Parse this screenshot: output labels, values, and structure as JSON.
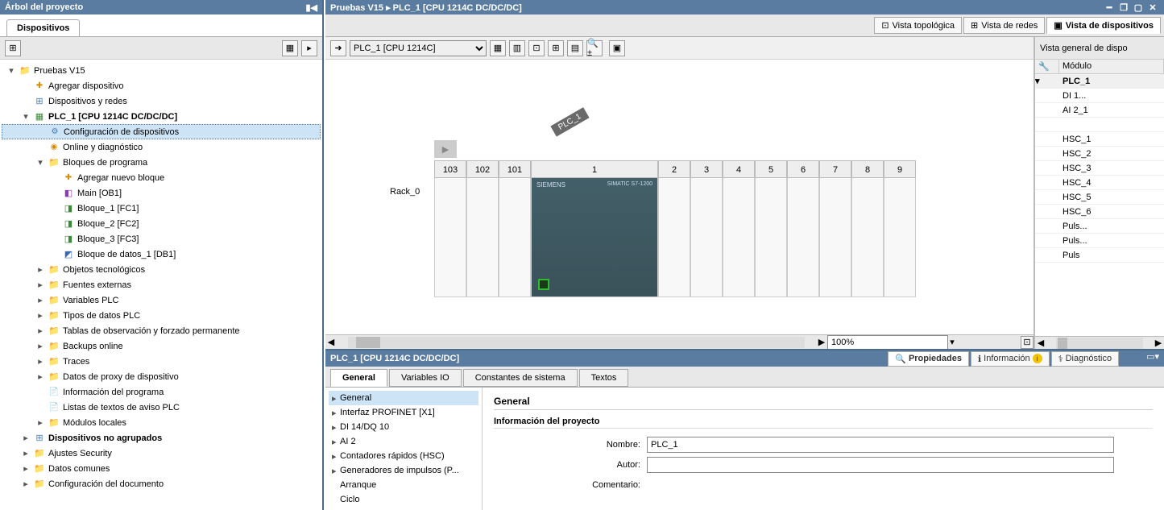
{
  "left_panel": {
    "title": "Árbol del proyecto",
    "tab": "Dispositivos",
    "tree": [
      {
        "level": 0,
        "exp": "▾",
        "icon": "ic-folder",
        "label": "Pruebas V15",
        "bold": false
      },
      {
        "level": 1,
        "exp": "",
        "icon": "ic-add",
        "label": "Agregar dispositivo",
        "bold": false
      },
      {
        "level": 1,
        "exp": "",
        "icon": "ic-net",
        "label": "Dispositivos y redes",
        "bold": false
      },
      {
        "level": 1,
        "exp": "▾",
        "icon": "ic-plc",
        "label": "PLC_1 [CPU 1214C DC/DC/DC]",
        "bold": true
      },
      {
        "level": 2,
        "exp": "",
        "icon": "ic-cfg",
        "label": "Configuración de dispositivos",
        "bold": false,
        "selected": true
      },
      {
        "level": 2,
        "exp": "",
        "icon": "ic-diag",
        "label": "Online y diagnóstico",
        "bold": false
      },
      {
        "level": 2,
        "exp": "▾",
        "icon": "ic-folder",
        "label": "Bloques de programa",
        "bold": false
      },
      {
        "level": 3,
        "exp": "",
        "icon": "ic-add",
        "label": "Agregar nuevo bloque",
        "bold": false
      },
      {
        "level": 3,
        "exp": "",
        "icon": "ic-ob",
        "label": "Main [OB1]",
        "bold": false
      },
      {
        "level": 3,
        "exp": "",
        "icon": "ic-fc",
        "label": "Bloque_1 [FC1]",
        "bold": false
      },
      {
        "level": 3,
        "exp": "",
        "icon": "ic-fc",
        "label": "Bloque_2 [FC2]",
        "bold": false
      },
      {
        "level": 3,
        "exp": "",
        "icon": "ic-fc",
        "label": "Bloque_3 [FC3]",
        "bold": false
      },
      {
        "level": 3,
        "exp": "",
        "icon": "ic-db",
        "label": "Bloque de datos_1 [DB1]",
        "bold": false
      },
      {
        "level": 2,
        "exp": "▸",
        "icon": "ic-folder",
        "label": "Objetos tecnológicos",
        "bold": false
      },
      {
        "level": 2,
        "exp": "▸",
        "icon": "ic-folder",
        "label": "Fuentes externas",
        "bold": false
      },
      {
        "level": 2,
        "exp": "▸",
        "icon": "ic-folder",
        "label": "Variables PLC",
        "bold": false
      },
      {
        "level": 2,
        "exp": "▸",
        "icon": "ic-folder",
        "label": "Tipos de datos PLC",
        "bold": false
      },
      {
        "level": 2,
        "exp": "▸",
        "icon": "ic-folder",
        "label": "Tablas de observación y forzado permanente",
        "bold": false
      },
      {
        "level": 2,
        "exp": "▸",
        "icon": "ic-folder",
        "label": "Backups online",
        "bold": false
      },
      {
        "level": 2,
        "exp": "▸",
        "icon": "ic-folder",
        "label": "Traces",
        "bold": false
      },
      {
        "level": 2,
        "exp": "▸",
        "icon": "ic-folder",
        "label": "Datos de proxy de dispositivo",
        "bold": false
      },
      {
        "level": 2,
        "exp": "",
        "icon": "ic-doc",
        "label": "Información del programa",
        "bold": false
      },
      {
        "level": 2,
        "exp": "",
        "icon": "ic-doc",
        "label": "Listas de textos de aviso PLC",
        "bold": false
      },
      {
        "level": 2,
        "exp": "▸",
        "icon": "ic-folder",
        "label": "Módulos locales",
        "bold": false
      },
      {
        "level": 1,
        "exp": "▸",
        "icon": "ic-net",
        "label": "Dispositivos no agrupados",
        "bold": true
      },
      {
        "level": 1,
        "exp": "▸",
        "icon": "ic-folder",
        "label": "Ajustes Security",
        "bold": false
      },
      {
        "level": 1,
        "exp": "▸",
        "icon": "ic-folder",
        "label": "Datos comunes",
        "bold": false
      },
      {
        "level": 1,
        "exp": "▸",
        "icon": "ic-folder",
        "label": "Configuración del documento",
        "bold": false
      }
    ]
  },
  "breadcrumb": "Pruebas V15  ▸  PLC_1 [CPU 1214C DC/DC/DC]",
  "view_tabs": {
    "topological": "Vista topológica",
    "networks": "Vista de redes",
    "devices": "Vista de dispositivos"
  },
  "device_selector": "PLC_1 [CPU 1214C]",
  "rack": {
    "tag": "PLC_1",
    "name": "Rack_0",
    "brand": "SIEMENS",
    "model": "SIMATIC S7-1200",
    "slots_left": [
      "103",
      "102",
      "101"
    ],
    "slot_main": "1",
    "slots_right": [
      "2",
      "3",
      "4",
      "5",
      "6",
      "7",
      "8",
      "9"
    ]
  },
  "zoom": "100%",
  "overview": {
    "title": "Vista general de dispo",
    "col_module": "Módulo",
    "rows": [
      {
        "exp": "▾",
        "label": "PLC_1",
        "head": true
      },
      {
        "exp": "",
        "label": "DI 1..."
      },
      {
        "exp": "",
        "label": "AI 2_1"
      },
      {
        "exp": "",
        "label": ""
      },
      {
        "exp": "",
        "label": "HSC_1"
      },
      {
        "exp": "",
        "label": "HSC_2"
      },
      {
        "exp": "",
        "label": "HSC_3"
      },
      {
        "exp": "",
        "label": "HSC_4"
      },
      {
        "exp": "",
        "label": "HSC_5"
      },
      {
        "exp": "",
        "label": "HSC_6"
      },
      {
        "exp": "",
        "label": "Puls..."
      },
      {
        "exp": "",
        "label": "Puls..."
      },
      {
        "exp": "",
        "label": "Puls"
      }
    ]
  },
  "properties": {
    "title": "PLC_1 [CPU 1214C DC/DC/DC]",
    "tabs_right": {
      "properties": "Propiedades",
      "info": "Información",
      "diag": "Diagnóstico"
    },
    "tabs2": [
      "General",
      "Variables IO",
      "Constantes de sistema",
      "Textos"
    ],
    "nav": [
      {
        "exp": "▸",
        "label": "General",
        "sel": true
      },
      {
        "exp": "▸",
        "label": "Interfaz PROFINET [X1]"
      },
      {
        "exp": "▸",
        "label": "DI 14/DQ 10"
      },
      {
        "exp": "▸",
        "label": "AI 2"
      },
      {
        "exp": "▸",
        "label": "Contadores rápidos (HSC)"
      },
      {
        "exp": "▸",
        "label": "Generadores de impulsos (P..."
      },
      {
        "exp": "",
        "label": "Arranque"
      },
      {
        "exp": "",
        "label": "Ciclo"
      }
    ],
    "heading": "General",
    "subheading": "Información del proyecto",
    "form": {
      "name_label": "Nombre:",
      "name_value": "PLC_1",
      "author_label": "Autor:",
      "author_value": "",
      "comment_label": "Comentario:"
    }
  }
}
